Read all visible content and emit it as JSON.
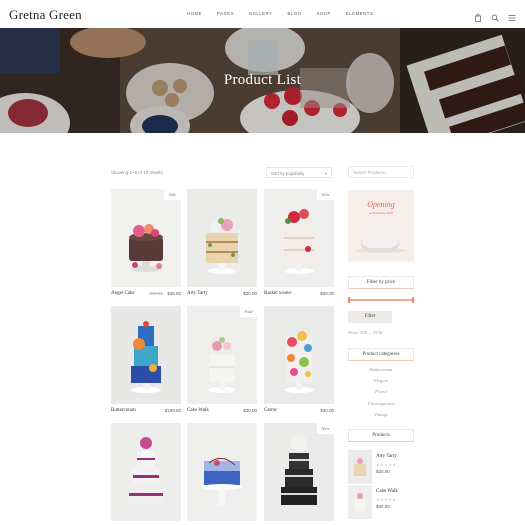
{
  "header": {
    "logo": "Gretna Green",
    "nav": [
      "HOME",
      "PAGES",
      "GALLERY",
      "BLOG",
      "SHOP",
      "ELEMENTS"
    ],
    "icons": [
      "cart-icon",
      "search-icon",
      "menu-icon"
    ]
  },
  "hero": {
    "title": "Product List"
  },
  "toolbar": {
    "results": "Showing 1–9 of 10 results",
    "sort": "Sort by popularity"
  },
  "products": [
    {
      "name": "Angel Cake",
      "old_price": "$40.00",
      "price": "$35.00",
      "badge": "Sale"
    },
    {
      "name": "Arty Tarty",
      "price": "$20.00",
      "badge": ""
    },
    {
      "name": "Basket weave",
      "price": "$20.00",
      "badge": "New"
    },
    {
      "name": "Buttercream",
      "price": "$100.00",
      "badge": ""
    },
    {
      "name": "Cake Walk",
      "price": "$30.00",
      "badge": "Sold"
    },
    {
      "name": "Carrot",
      "price": "$30.00",
      "badge": ""
    },
    {
      "name": "",
      "price": "",
      "badge": ""
    },
    {
      "name": "",
      "price": "",
      "badge": ""
    },
    {
      "name": "",
      "price": "",
      "badge": "New"
    }
  ],
  "sidebar": {
    "search_placeholder": "Search Products...",
    "promo": {
      "title": "Opening",
      "subtitle": "in February 2016"
    },
    "filter_title": "Filter by price",
    "filter_button": "Filter",
    "price_range": "Price: $20 — $130",
    "categories_title": "Product categories",
    "categories": [
      "Buttercream",
      "Elegant",
      "Floral",
      "Uncategorized",
      "Vintage"
    ],
    "products_title": "Products",
    "products": [
      {
        "name": "Arty Tarty",
        "stars": "★★★★★",
        "price": "$20.00"
      },
      {
        "name": "Cake Walk",
        "stars": "★★★★★",
        "price": "$30.00"
      }
    ]
  },
  "colors": {
    "accent": "#f4a58c",
    "text": "#333333",
    "muted": "#999999"
  }
}
